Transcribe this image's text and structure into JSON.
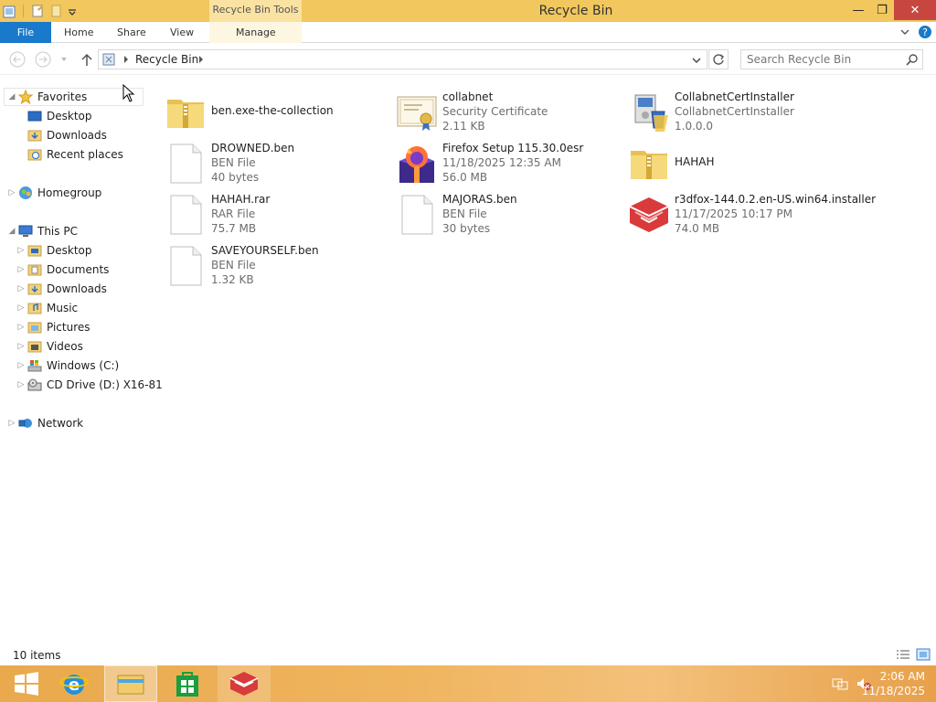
{
  "window": {
    "title": "Recycle Bin",
    "context_tab_group": "Recycle Bin Tools",
    "minimize": "—",
    "maximize": "❐",
    "close": "✕"
  },
  "ribbon": {
    "file": "File",
    "tabs": [
      "Home",
      "Share",
      "View",
      "Manage"
    ]
  },
  "address": {
    "path": "Recycle Bin",
    "search_placeholder": "Search Recycle Bin"
  },
  "nav": {
    "favorites": {
      "label": "Favorites",
      "items": [
        "Desktop",
        "Downloads",
        "Recent places"
      ]
    },
    "homegroup": "Homegroup",
    "this_pc": {
      "label": "This PC",
      "items": [
        "Desktop",
        "Documents",
        "Downloads",
        "Music",
        "Pictures",
        "Videos",
        "Windows (C:)",
        "CD Drive (D:) X16-81"
      ]
    },
    "network": "Network"
  },
  "items": [
    {
      "name": "ben.exe-the-collection",
      "l2": "",
      "l3": "",
      "icon": "zip-folder-icon"
    },
    {
      "name": "collabnet",
      "l2": "Security Certificate",
      "l3": "2.11 KB",
      "icon": "certificate-icon"
    },
    {
      "name": "CollabnetCertInstaller",
      "l2": "CollabnetCertInstaller",
      "l3": "1.0.0.0",
      "icon": "installer-icon"
    },
    {
      "name": "DROWNED.ben",
      "l2": "BEN File",
      "l3": "40 bytes",
      "icon": "blank-file-icon"
    },
    {
      "name": "Firefox Setup 115.30.0esr",
      "l2": "11/18/2025 12:35 AM",
      "l3": "56.0 MB",
      "icon": "firefox-installer-icon"
    },
    {
      "name": "HAHAH",
      "l2": "",
      "l3": "",
      "icon": "zip-folder-icon"
    },
    {
      "name": "HAHAH.rar",
      "l2": "RAR File",
      "l3": "75.7 MB",
      "icon": "blank-file-icon"
    },
    {
      "name": "MAJORAS.ben",
      "l2": "BEN File",
      "l3": "30 bytes",
      "icon": "blank-file-icon"
    },
    {
      "name": "r3dfox-144.0.2.en-US.win64.installer",
      "l2": "11/17/2025 10:17 PM",
      "l3": "74.0 MB",
      "icon": "r3dfox-icon"
    },
    {
      "name": "SAVEYOURSELF.ben",
      "l2": "BEN File",
      "l3": "1.32 KB",
      "icon": "blank-file-icon"
    }
  ],
  "status": {
    "count": "10 items"
  },
  "taskbar": {
    "time": "2:06 AM",
    "date": "11/18/2025"
  },
  "colors": {
    "titlebar": "#f1c75e",
    "file_tab": "#1979ca",
    "close": "#c7463f",
    "taskbar": "#f0b560"
  }
}
